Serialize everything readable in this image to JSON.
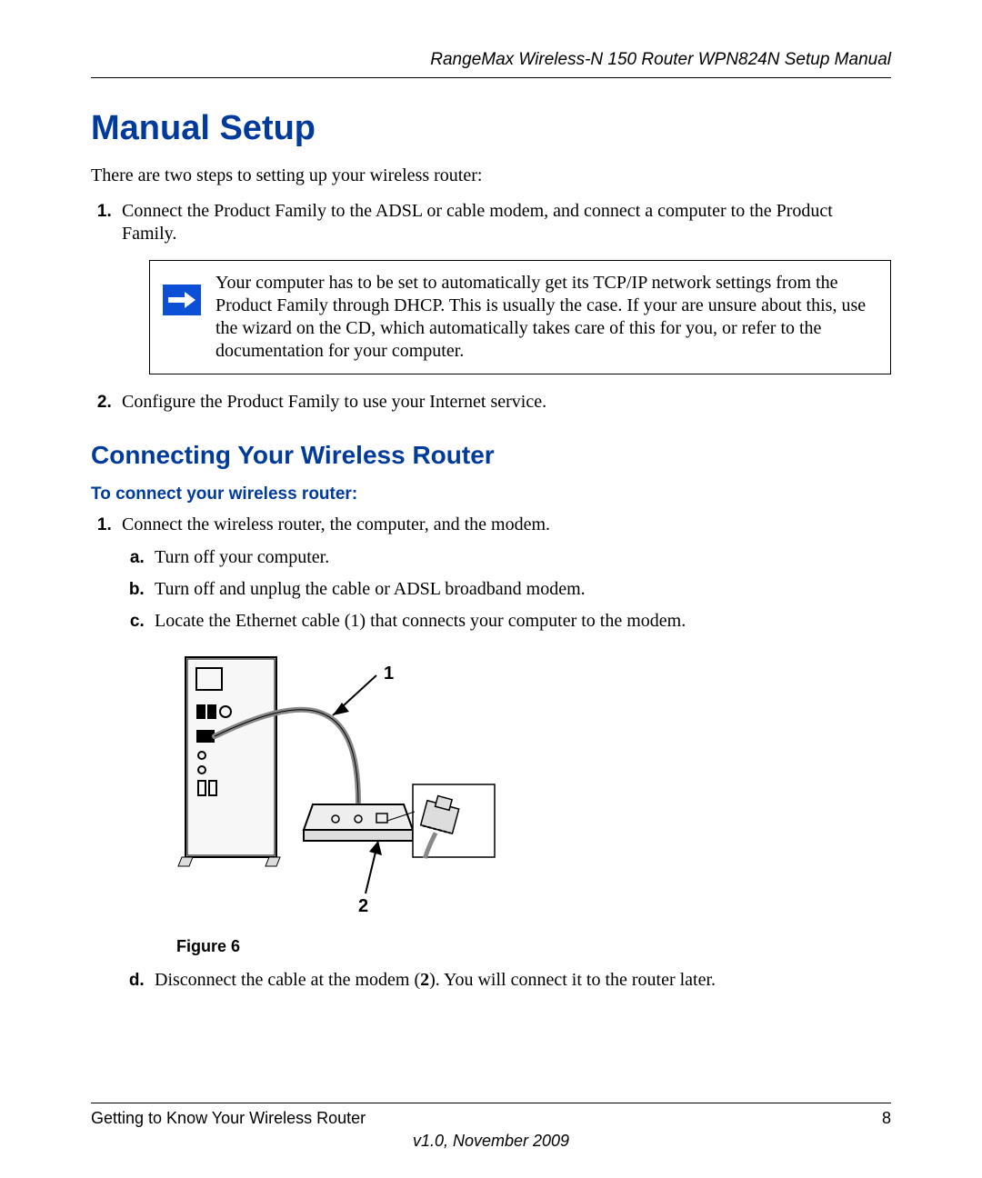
{
  "header": {
    "running_head": "RangeMax Wireless-N 150 Router WPN824N Setup Manual"
  },
  "title": "Manual Setup",
  "intro": "There are two steps to setting up your wireless router:",
  "steps": {
    "s1": "Connect the Product Family to the ADSL or cable modem, and connect a computer to the Product Family.",
    "s2": "Configure the Product Family to use your Internet service."
  },
  "note": {
    "icon": "arrow-right-icon",
    "text": "Your computer has to be set to automatically get its TCP/IP network settings from the Product Family through DHCP. This is usually the case. If your are unsure about this, use the wizard on the CD, which automatically takes care of this for you, or refer to the documentation for your computer."
  },
  "section2": {
    "heading": "Connecting Your Wireless Router",
    "instr_heading": "To connect your wireless router:",
    "step1": "Connect the wireless router, the computer, and the modem.",
    "sub": {
      "a": "Turn off your computer.",
      "b": "Turn off and unplug the cable or ADSL broadband modem.",
      "c": "Locate the Ethernet cable (1) that connects your computer to the modem.",
      "d_pre": "Disconnect the cable at the modem (",
      "d_num": "2",
      "d_post": "). You will connect it to the router later."
    }
  },
  "figure": {
    "label_1": "1",
    "label_2": "2",
    "caption": "Figure 6"
  },
  "footer": {
    "left": "Getting to Know Your Wireless Router",
    "page": "8",
    "version": "v1.0, November 2009"
  }
}
